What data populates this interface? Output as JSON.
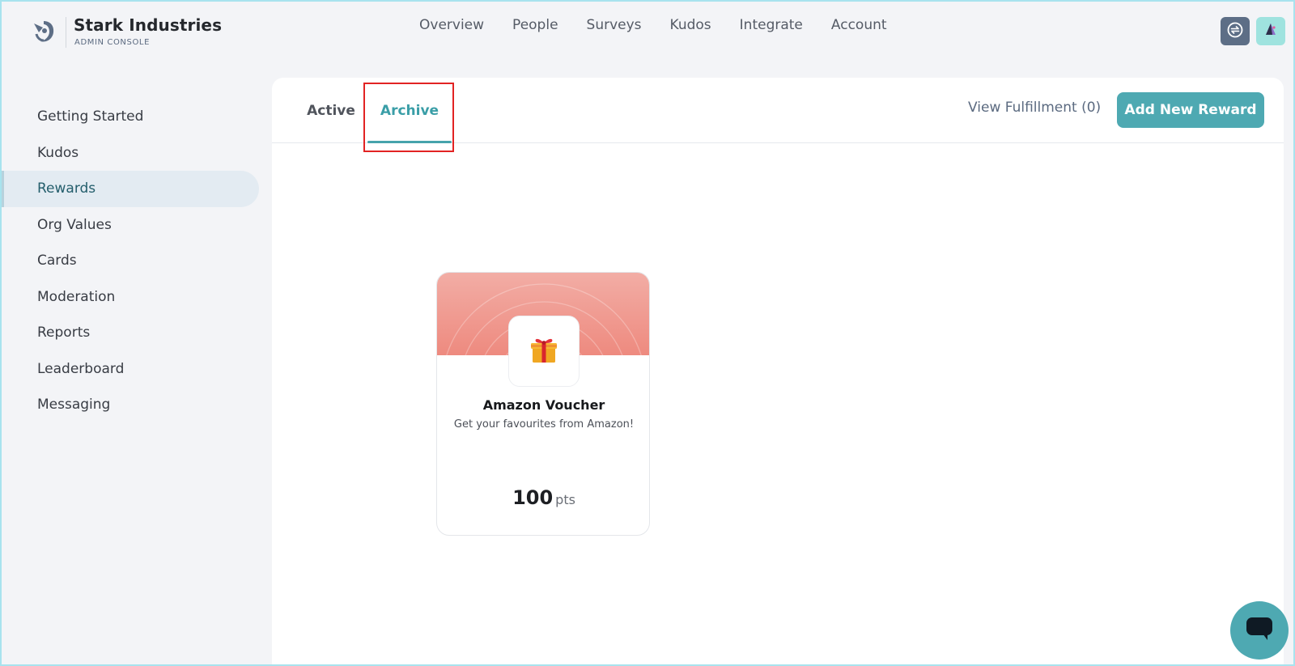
{
  "brand": {
    "name": "Stark Industries",
    "subtitle": "ADMIN CONSOLE"
  },
  "topnav": [
    "Overview",
    "People",
    "Surveys",
    "Kudos",
    "Integrate",
    "Account"
  ],
  "sidebar": {
    "items": [
      {
        "label": "Getting Started"
      },
      {
        "label": "Kudos"
      },
      {
        "label": "Rewards",
        "active": true
      },
      {
        "label": "Org Values"
      },
      {
        "label": "Cards"
      },
      {
        "label": "Moderation"
      },
      {
        "label": "Reports"
      },
      {
        "label": "Leaderboard"
      },
      {
        "label": "Messaging"
      }
    ]
  },
  "tabs": {
    "active_label": "Active",
    "archive_label": "Archive",
    "selected": "Archive"
  },
  "actions": {
    "view_fulfillment": "View Fulfillment (0)",
    "add_reward": "Add New Reward"
  },
  "reward": {
    "title": "Amazon Voucher",
    "description": "Get your favourites from Amazon!",
    "points": "100",
    "points_unit": "pts",
    "icon": "gift-icon"
  },
  "colors": {
    "accent": "#4ea9b2",
    "banner": "#ee8a7f",
    "highlight": "#e22323"
  }
}
